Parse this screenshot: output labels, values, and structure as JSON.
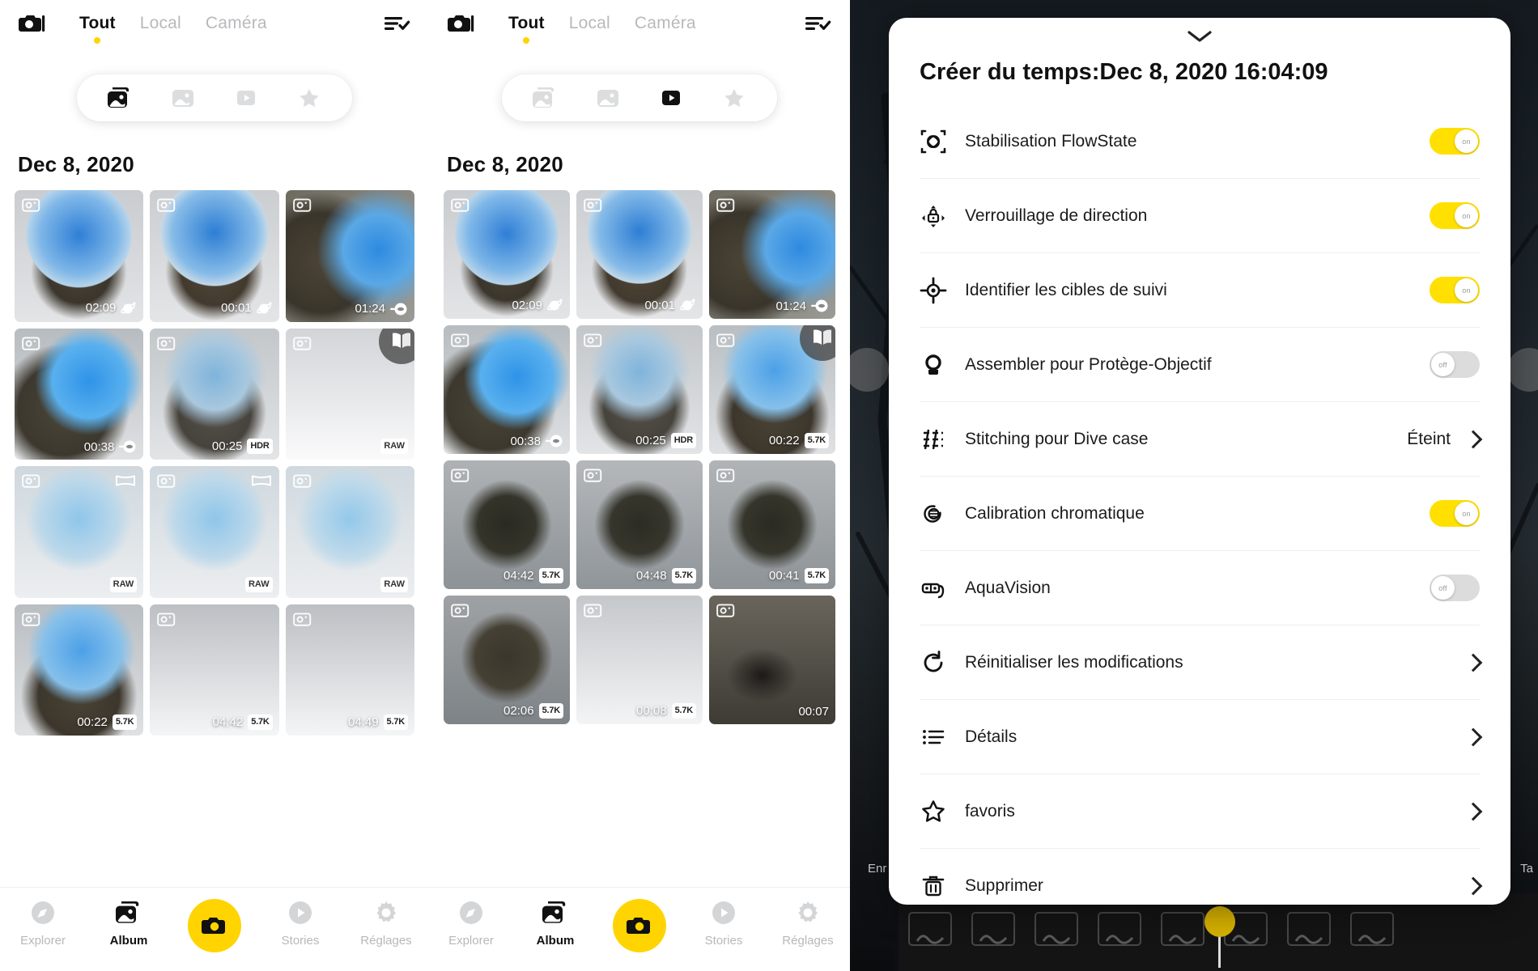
{
  "app": {
    "accent_yellow": "#ffd400",
    "toggle_on_color": "#ffe000",
    "toggle_off_color": "#dcdcdc"
  },
  "panel_left": {
    "camera_icon": "camera-icon",
    "sort_icon": "sort-check-icon",
    "tabs": [
      {
        "label": "Tout",
        "active": true
      },
      {
        "label": "Local",
        "active": false
      },
      {
        "label": "Caméra",
        "active": false
      }
    ],
    "filters": [
      {
        "name": "all-media-filter",
        "icon": "stack-photo-icon",
        "active": true
      },
      {
        "name": "photo-filter",
        "icon": "photo-icon",
        "active": false
      },
      {
        "name": "video-filter",
        "icon": "play-icon",
        "active": false
      },
      {
        "name": "favorite-filter",
        "icon": "star-icon",
        "active": false
      }
    ],
    "date_heading": "Dec 8, 2020",
    "items": [
      {
        "duration": "02:09",
        "tag": "",
        "icon": "planet-icon",
        "kind": "sky",
        "corner": ""
      },
      {
        "duration": "00:01",
        "tag": "",
        "icon": "planet-icon",
        "kind": "sky",
        "corner": ""
      },
      {
        "duration": "01:24",
        "tag": "",
        "icon": "capsule-icon",
        "kind": "dark",
        "corner": ""
      },
      {
        "duration": "00:38",
        "tag": "",
        "icon": "capsule-icon",
        "kind": "blue",
        "corner": ""
      },
      {
        "duration": "00:25",
        "tag": "HDR",
        "icon": "",
        "kind": "lake",
        "corner": ""
      },
      {
        "duration": "",
        "tag": "RAW",
        "icon": "",
        "kind": "blank",
        "corner": "",
        "fab": "book-icon"
      },
      {
        "duration": "",
        "tag": "RAW",
        "icon": "",
        "kind": "pale",
        "corner": "pano-icon"
      },
      {
        "duration": "",
        "tag": "RAW",
        "icon": "",
        "kind": "pale",
        "corner": "pano-icon"
      },
      {
        "duration": "",
        "tag": "RAW",
        "icon": "",
        "kind": "pale",
        "corner": ""
      },
      {
        "duration": "00:22",
        "tag": "5.7K",
        "icon": "",
        "kind": "person",
        "corner": ""
      },
      {
        "duration": "04:42",
        "tag": "5.7K",
        "icon": "",
        "kind": "blank",
        "corner": ""
      },
      {
        "duration": "04:49",
        "tag": "5.7K",
        "icon": "",
        "kind": "blank",
        "corner": ""
      }
    ],
    "bottom_nav": [
      {
        "label": "Explorer",
        "icon": "compass-icon",
        "active": false
      },
      {
        "label": "Album",
        "icon": "stack-photo-icon",
        "active": true
      },
      {
        "label": "",
        "icon": "shutter-camera-icon",
        "active": false
      },
      {
        "label": "Stories",
        "icon": "play-circle-icon",
        "active": false
      },
      {
        "label": "Réglages",
        "icon": "gear-icon",
        "active": false
      }
    ]
  },
  "panel_mid": {
    "camera_icon": "camera-icon",
    "sort_icon": "sort-check-icon",
    "tabs": [
      {
        "label": "Tout",
        "active": true
      },
      {
        "label": "Local",
        "active": false
      },
      {
        "label": "Caméra",
        "active": false
      }
    ],
    "filters": [
      {
        "name": "all-media-filter",
        "icon": "stack-photo-icon",
        "active": false
      },
      {
        "name": "photo-filter",
        "icon": "photo-icon",
        "active": false
      },
      {
        "name": "video-filter",
        "icon": "play-icon",
        "active": true
      },
      {
        "name": "favorite-filter",
        "icon": "star-icon",
        "active": false
      }
    ],
    "date_heading": "Dec 8, 2020",
    "items": [
      {
        "duration": "02:09",
        "tag": "",
        "icon": "planet-icon",
        "kind": "sky",
        "corner": ""
      },
      {
        "duration": "00:01",
        "tag": "",
        "icon": "planet-icon",
        "kind": "sky",
        "corner": ""
      },
      {
        "duration": "01:24",
        "tag": "",
        "icon": "capsule-icon",
        "kind": "dark",
        "corner": ""
      },
      {
        "duration": "00:38",
        "tag": "",
        "icon": "capsule-icon",
        "kind": "blue",
        "corner": ""
      },
      {
        "duration": "00:25",
        "tag": "HDR",
        "icon": "",
        "kind": "lake",
        "corner": ""
      },
      {
        "duration": "00:22",
        "tag": "5.7K",
        "icon": "",
        "kind": "person",
        "corner": "",
        "fab": "book-icon"
      },
      {
        "duration": "04:42",
        "tag": "5.7K",
        "icon": "",
        "kind": "forest",
        "corner": ""
      },
      {
        "duration": "04:48",
        "tag": "5.7K",
        "icon": "",
        "kind": "forest",
        "corner": ""
      },
      {
        "duration": "00:41",
        "tag": "5.7K",
        "icon": "",
        "kind": "forest",
        "corner": ""
      },
      {
        "duration": "02:06",
        "tag": "5.7K",
        "icon": "",
        "kind": "dirt",
        "corner": ""
      },
      {
        "duration": "00:08",
        "tag": "5.7K",
        "icon": "",
        "kind": "blank",
        "corner": ""
      },
      {
        "duration": "00:07",
        "tag": "",
        "icon": "",
        "kind": "woods",
        "corner": ""
      }
    ],
    "bottom_nav": [
      {
        "label": "Explorer",
        "icon": "compass-icon",
        "active": false
      },
      {
        "label": "Album",
        "icon": "stack-photo-icon",
        "active": true
      },
      {
        "label": "",
        "icon": "shutter-camera-icon",
        "active": false
      },
      {
        "label": "Stories",
        "icon": "play-circle-icon",
        "active": false
      },
      {
        "label": "Réglages",
        "icon": "gear-icon",
        "active": false
      }
    ]
  },
  "panel_right": {
    "side_labels": {
      "left": "Enr",
      "right": "Ta"
    },
    "sheet": {
      "collapse_icon": "chevron-down-icon",
      "title": "Créer du temps:Dec 8, 2020 16:04:09",
      "rows": [
        {
          "icon": "flowstate-icon",
          "label": "Stabilisation FlowState",
          "control": "toggle",
          "state": "on",
          "state_label": "on"
        },
        {
          "icon": "direction-lock-icon",
          "label": "Verrouillage de direction",
          "control": "toggle",
          "state": "on",
          "state_label": "on"
        },
        {
          "icon": "target-icon",
          "label": "Identifier les cibles de suivi",
          "control": "toggle",
          "state": "on",
          "state_label": "on"
        },
        {
          "icon": "lens-guard-icon",
          "label": "Assembler pour Protège-Objectif",
          "control": "toggle",
          "state": "off",
          "state_label": "off"
        },
        {
          "icon": "stitching-icon",
          "label": "Stitching pour Dive case",
          "control": "value",
          "value": "Éteint"
        },
        {
          "icon": "chroma-icon",
          "label": "Calibration chromatique",
          "control": "toggle",
          "state": "on",
          "state_label": "on"
        },
        {
          "icon": "goggles-icon",
          "label": "AquaVision",
          "control": "toggle",
          "state": "off",
          "state_label": "off"
        },
        {
          "icon": "reset-icon",
          "label": "Réinitialiser les modifications",
          "control": "chevron"
        },
        {
          "icon": "details-list-icon",
          "label": "Détails",
          "control": "chevron"
        },
        {
          "icon": "star-icon",
          "label": "favoris",
          "control": "chevron"
        },
        {
          "icon": "trash-icon",
          "label": "Supprimer",
          "control": "chevron"
        }
      ]
    }
  }
}
